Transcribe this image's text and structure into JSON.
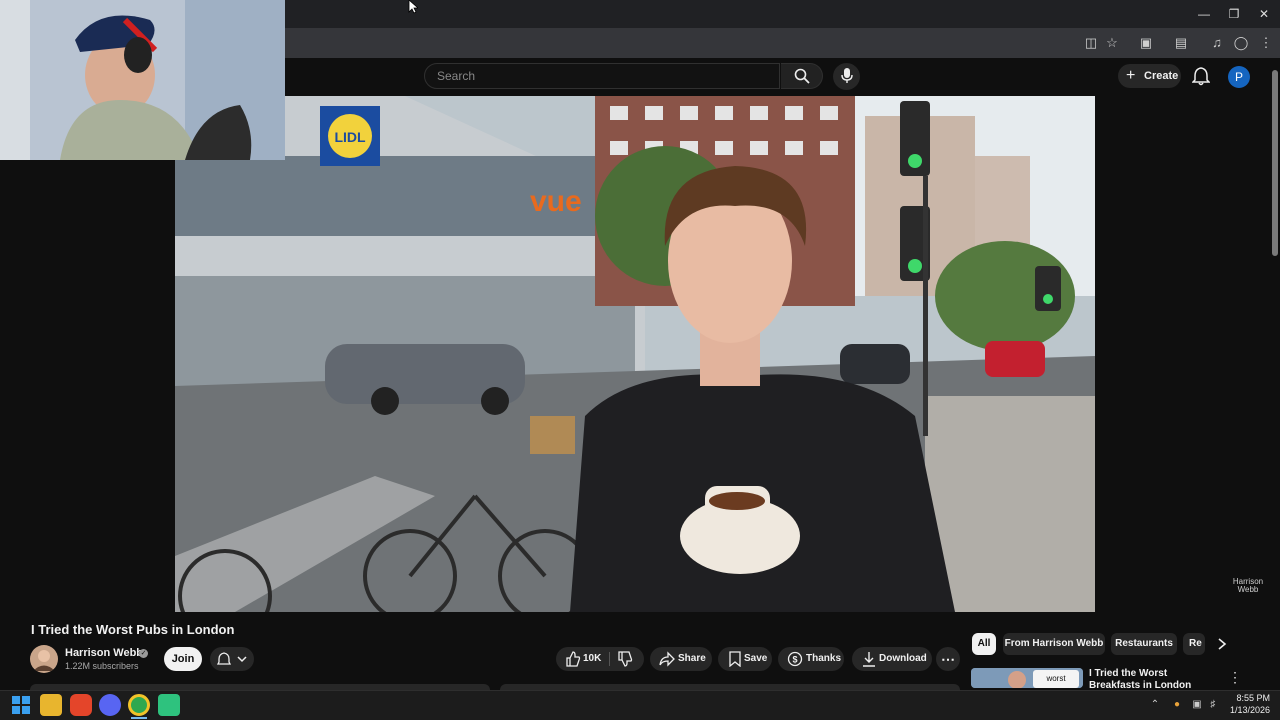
{
  "header": {
    "search_placeholder": "Search",
    "create_label": "Create",
    "avatar_letter": "P"
  },
  "video": {
    "title": "I Tried the Worst Pubs in London",
    "watermark": "Harrison Webb",
    "scene_text": {
      "store_sign": "LIDL",
      "cinema_sign": "vue"
    }
  },
  "channel": {
    "name": "Harrison Webb",
    "subscribers": "1.22M subscribers",
    "join_label": "Join"
  },
  "actions": {
    "like_count": "10K",
    "share_label": "Share",
    "save_label": "Save",
    "thanks_label": "Thanks",
    "download_label": "Download"
  },
  "chips": [
    "All",
    "From Harrison Webb",
    "Restaurants",
    "Re"
  ],
  "recommendation": {
    "title": "I Tried the Worst Breakfasts in London",
    "thumb_text": "worst"
  },
  "taskbar": {
    "time": "8:55 PM",
    "date": "1/13/2026"
  },
  "colors": {
    "background": "#0f0f0f",
    "surface": "#272727",
    "avatar_blue": "#1565c0",
    "taskbar": "#1c1c1c"
  }
}
